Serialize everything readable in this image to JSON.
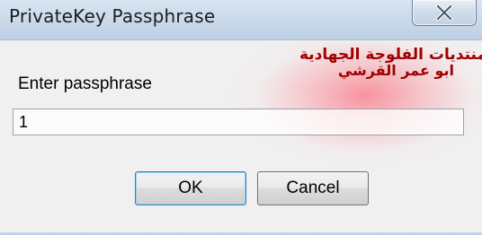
{
  "window": {
    "title": "PrivateKey Passphrase"
  },
  "watermark": {
    "line1": "منتديات الفلوجة الجهادية",
    "line2": "ابو عمر القرشي"
  },
  "form": {
    "prompt_label": "Enter passphrase",
    "passphrase_value": "1"
  },
  "buttons": {
    "ok_label": "OK",
    "cancel_label": "Cancel"
  },
  "icons": {
    "close": "close-icon"
  },
  "colors": {
    "titlebar": "#c9d9ea",
    "dialog_bg": "#f0f0f0",
    "watermark_text": "#a00000",
    "watermark_glow": "#ff4a5a"
  }
}
